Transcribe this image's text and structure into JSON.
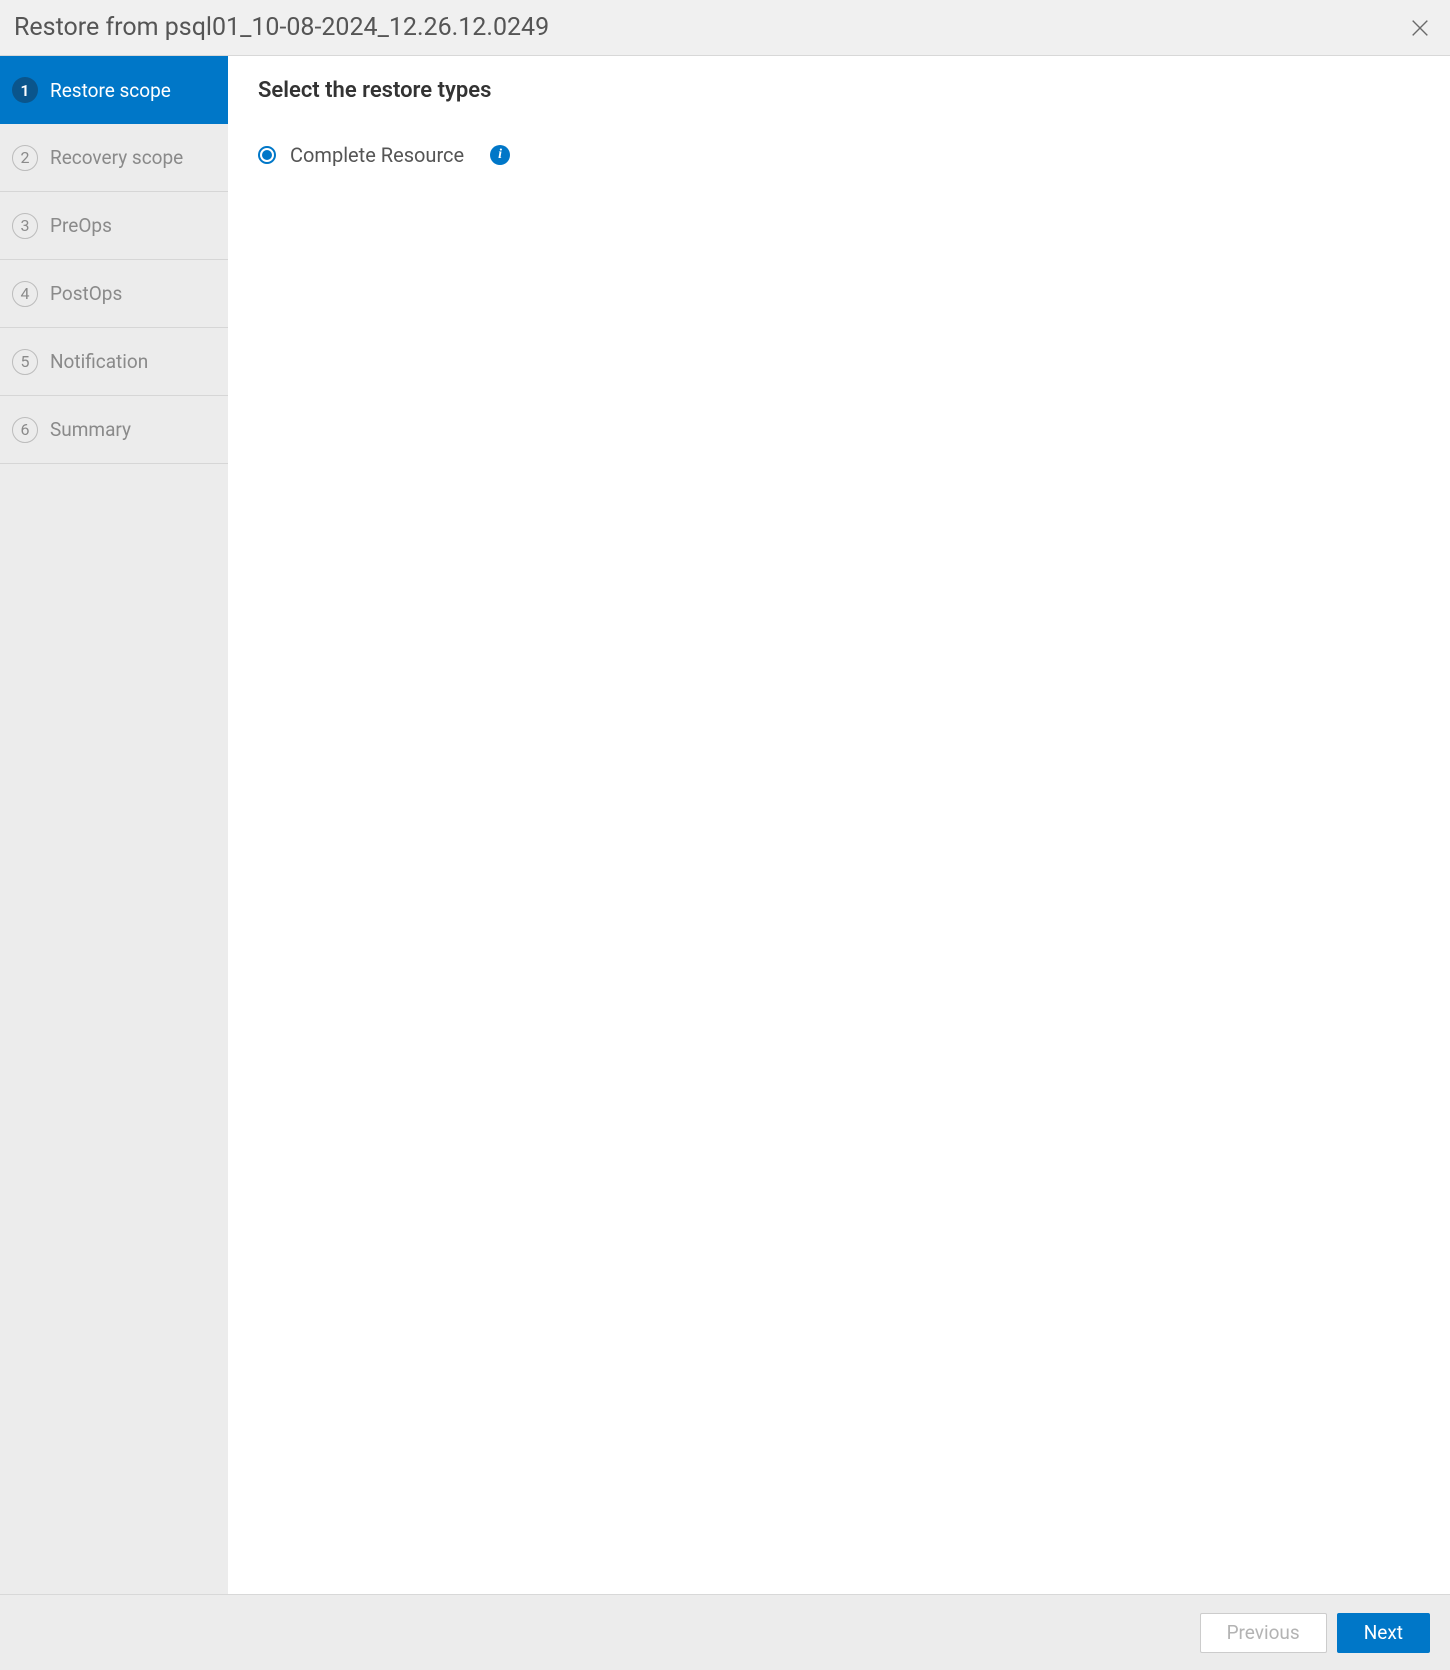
{
  "header": {
    "title": "Restore from psql01_10-08-2024_12.26.12.0249"
  },
  "sidebar": {
    "steps": [
      {
        "num": "1",
        "label": "Restore scope"
      },
      {
        "num": "2",
        "label": "Recovery scope"
      },
      {
        "num": "3",
        "label": "PreOps"
      },
      {
        "num": "4",
        "label": "PostOps"
      },
      {
        "num": "5",
        "label": "Notification"
      },
      {
        "num": "6",
        "label": "Summary"
      }
    ]
  },
  "main": {
    "heading": "Select the restore types",
    "option_label": "Complete Resource",
    "info_glyph": "i"
  },
  "footer": {
    "previous": "Previous",
    "next": "Next"
  }
}
